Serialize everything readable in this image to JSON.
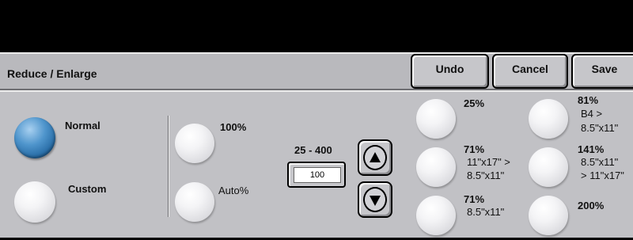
{
  "header": {
    "title": "Reduce / Enlarge",
    "undo_label": "Undo",
    "cancel_label": "Cancel",
    "save_label": "Save"
  },
  "mode": {
    "normal_label": "Normal",
    "custom_label": "Custom",
    "selected": "Normal"
  },
  "quick": {
    "p100_label": "100%",
    "auto_label": "Auto%"
  },
  "custom_input": {
    "range_label": "25 - 400",
    "value": "100"
  },
  "presets": {
    "p25": {
      "pct": "25%"
    },
    "p71a": {
      "pct": "71%",
      "line1": "11\"x17\" >",
      "line2": "8.5\"x11\""
    },
    "p71b": {
      "pct": "71%",
      "line1": "8.5\"x11\""
    },
    "p81": {
      "pct": "81%",
      "line1": "B4 >",
      "line2": "8.5\"x11\""
    },
    "p141": {
      "pct": "141%",
      "line1": "8.5\"x11\"",
      "line2": "> 11\"x17\""
    },
    "p200": {
      "pct": "200%"
    }
  },
  "colors": {
    "selected_button": "#2f78b6",
    "background": "#c1c1c5",
    "header": "#b9b9bd"
  }
}
